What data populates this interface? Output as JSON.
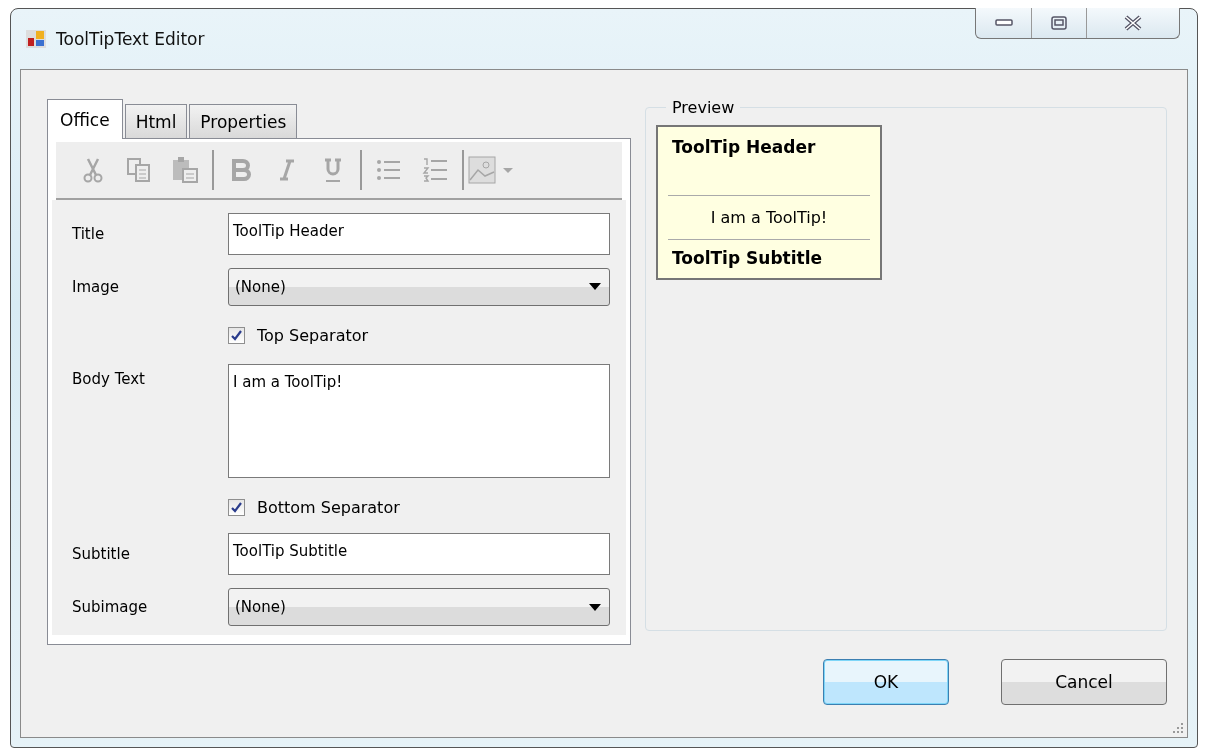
{
  "window": {
    "title": "ToolTipText Editor"
  },
  "tabs": [
    {
      "label": "Office",
      "selected": true
    },
    {
      "label": "Html",
      "selected": false
    },
    {
      "label": "Properties",
      "selected": false
    }
  ],
  "toolbar": [
    {
      "kind": "cut",
      "disabled": true
    },
    {
      "kind": "copy",
      "disabled": true
    },
    {
      "kind": "paste",
      "disabled": true
    },
    {
      "kind": "sep"
    },
    {
      "kind": "bold",
      "disabled": true
    },
    {
      "kind": "italic",
      "disabled": true
    },
    {
      "kind": "underline",
      "disabled": true
    },
    {
      "kind": "sep"
    },
    {
      "kind": "bullets",
      "disabled": true
    },
    {
      "kind": "numbers",
      "disabled": true
    },
    {
      "kind": "sep"
    },
    {
      "kind": "image",
      "disabled": true
    }
  ],
  "form": [
    {
      "kind": "text",
      "label": "Title",
      "value": "ToolTip Header"
    },
    {
      "kind": "combo",
      "label": "Image",
      "value": "(None)"
    },
    {
      "kind": "check",
      "label": "Top Separator",
      "checked": true
    },
    {
      "kind": "area",
      "label": "Body Text",
      "value": "I am a ToolTip!"
    },
    {
      "kind": "check",
      "label": "Bottom Separator",
      "checked": true
    },
    {
      "kind": "text",
      "label": "Subtitle",
      "value": "ToolTip Subtitle"
    },
    {
      "kind": "combo",
      "label": "Subimage",
      "value": "(None)"
    }
  ],
  "preview": {
    "label": "Preview",
    "header": "ToolTip Header",
    "body": "I am a ToolTip!",
    "subtitle": "ToolTip Subtitle"
  },
  "buttons": [
    {
      "label": "OK",
      "default": true
    },
    {
      "label": "Cancel",
      "default": false
    }
  ]
}
